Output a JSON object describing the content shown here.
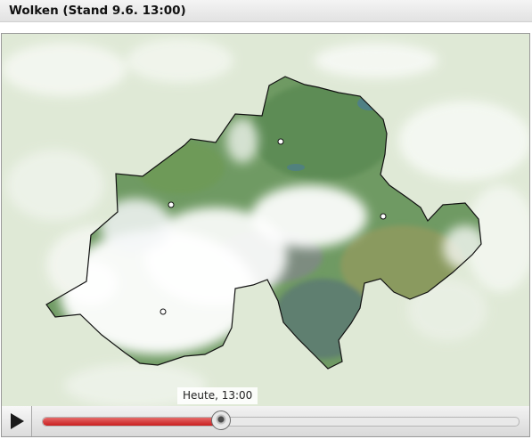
{
  "title": "Wolken (Stand 9.6. 13:00)",
  "time_label": "Heute, 13:00",
  "player": {
    "progress_fraction": 0.375,
    "play_icon": "play-icon"
  },
  "map": {
    "description_layer": "cloud-cover overlay on relief map of Switzerland",
    "colors": {
      "background": "#dfe9d6",
      "land": "#6f9a63",
      "cloud": "#ffffff",
      "border": "#111111"
    }
  }
}
